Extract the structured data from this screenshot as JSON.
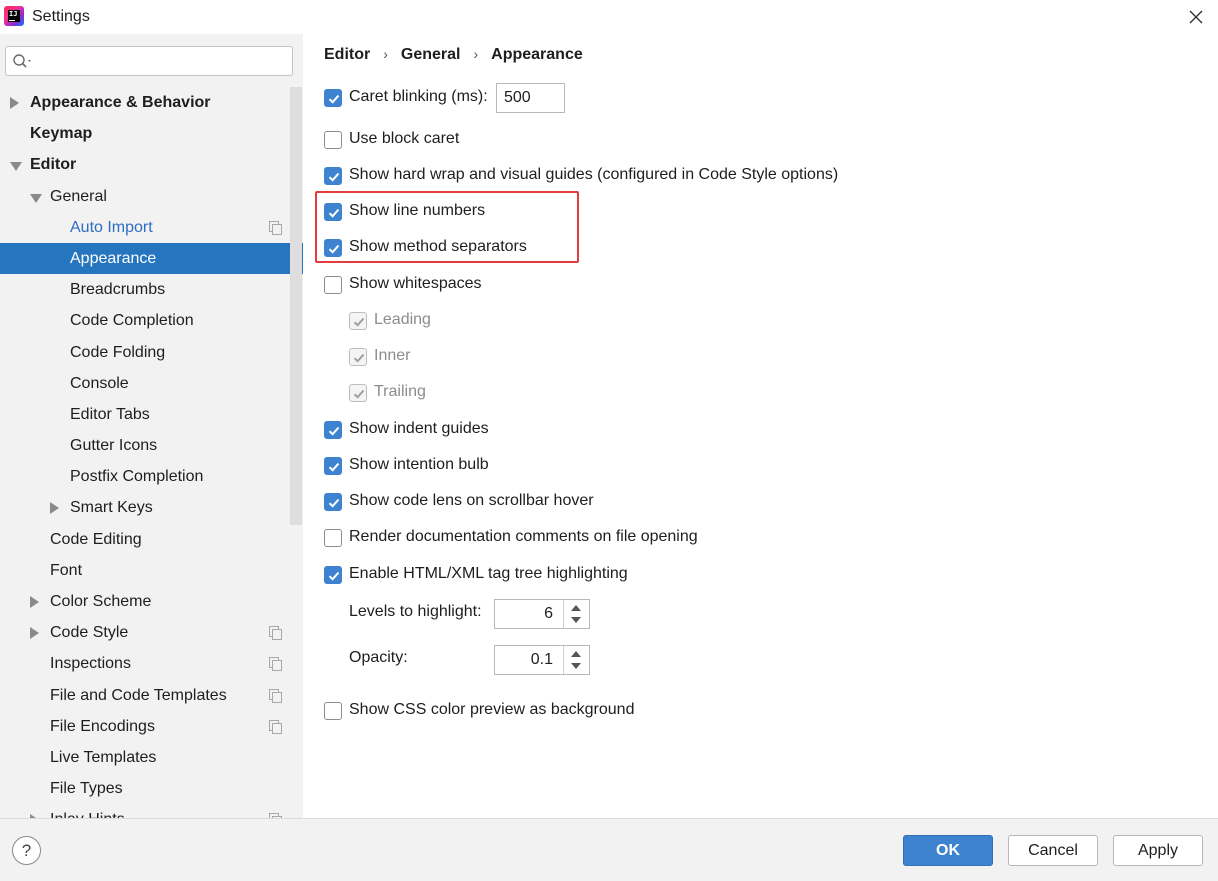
{
  "window": {
    "title": "Settings",
    "close_icon": "close-icon"
  },
  "search": {
    "placeholder": "",
    "value": ""
  },
  "sidebar": {
    "items": [
      {
        "label": "Appearance & Behavior",
        "level": 0,
        "bold": true,
        "arrow": "right"
      },
      {
        "label": "Keymap",
        "level": 0,
        "bold": true
      },
      {
        "label": "Editor",
        "level": 0,
        "bold": true,
        "arrow": "down"
      },
      {
        "label": "General",
        "level": 1,
        "arrow": "down"
      },
      {
        "label": "Auto Import",
        "level": 2,
        "link": true,
        "copy": true
      },
      {
        "label": "Appearance",
        "level": 2,
        "selected": true
      },
      {
        "label": "Breadcrumbs",
        "level": 2
      },
      {
        "label": "Code Completion",
        "level": 2
      },
      {
        "label": "Code Folding",
        "level": 2
      },
      {
        "label": "Console",
        "level": 2
      },
      {
        "label": "Editor Tabs",
        "level": 2
      },
      {
        "label": "Gutter Icons",
        "level": 2
      },
      {
        "label": "Postfix Completion",
        "level": 2
      },
      {
        "label": "Smart Keys",
        "level": 2,
        "arrow": "right"
      },
      {
        "label": "Code Editing",
        "level": 1
      },
      {
        "label": "Font",
        "level": 1
      },
      {
        "label": "Color Scheme",
        "level": 1,
        "arrow": "right"
      },
      {
        "label": "Code Style",
        "level": 1,
        "arrow": "right",
        "copy": true
      },
      {
        "label": "Inspections",
        "level": 1,
        "copy": true
      },
      {
        "label": "File and Code Templates",
        "level": 1,
        "copy": true
      },
      {
        "label": "File Encodings",
        "level": 1,
        "copy": true
      },
      {
        "label": "Live Templates",
        "level": 1
      },
      {
        "label": "File Types",
        "level": 1
      },
      {
        "label": "Inlay Hints",
        "level": 1,
        "arrow": "right",
        "copy": true
      }
    ]
  },
  "breadcrumb": [
    "Editor",
    "General",
    "Appearance"
  ],
  "options": {
    "caret_blinking": {
      "label": "Caret blinking (ms):",
      "checked": true,
      "value": "500"
    },
    "block_caret": {
      "label": "Use block caret",
      "checked": false
    },
    "hard_wrap": {
      "label": "Show hard wrap and visual guides (configured in Code Style options)",
      "checked": true
    },
    "line_numbers": {
      "label": "Show line numbers",
      "checked": true
    },
    "method_separators": {
      "label": "Show method separators",
      "checked": true
    },
    "whitespaces": {
      "label": "Show whitespaces",
      "checked": false
    },
    "leading": {
      "label": "Leading",
      "checked": true,
      "disabled": true
    },
    "inner": {
      "label": "Inner",
      "checked": true,
      "disabled": true
    },
    "trailing": {
      "label": "Trailing",
      "checked": true,
      "disabled": true
    },
    "indent_guides": {
      "label": "Show indent guides",
      "checked": true
    },
    "intention_bulb": {
      "label": "Show intention bulb",
      "checked": true
    },
    "code_lens": {
      "label": "Show code lens on scrollbar hover",
      "checked": true
    },
    "render_docs": {
      "label": "Render documentation comments on file opening",
      "checked": false
    },
    "tag_tree": {
      "label": "Enable HTML/XML tag tree highlighting",
      "checked": true
    },
    "levels": {
      "label": "Levels to highlight:",
      "value": "6"
    },
    "opacity": {
      "label": "Opacity:",
      "value": "0.1"
    },
    "css_preview": {
      "label": "Show CSS color preview as background",
      "checked": false
    }
  },
  "buttons": {
    "ok": "OK",
    "cancel": "Cancel",
    "apply": "Apply",
    "help": "?"
  },
  "colors": {
    "accent": "#3d83d0",
    "selection": "#2675bf",
    "highlight_border": "#e23c3c",
    "link": "#2e6ec0"
  }
}
